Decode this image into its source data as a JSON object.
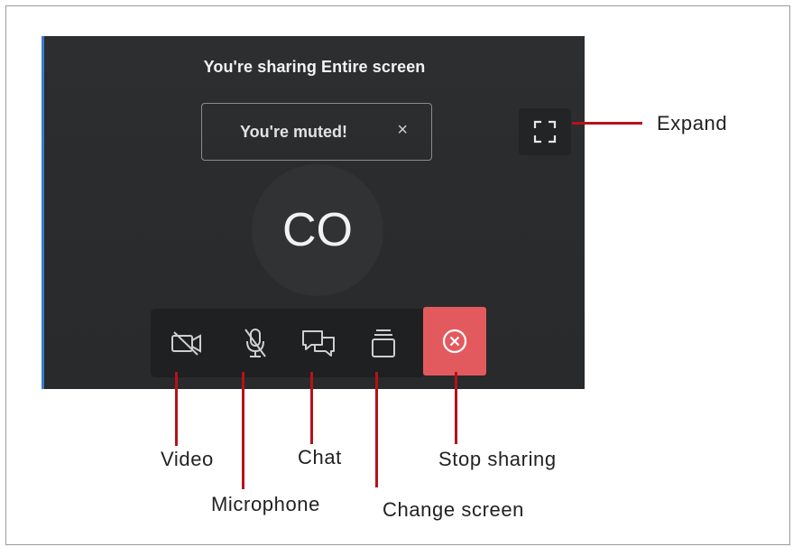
{
  "screen": {
    "share_title": "You're sharing Entire screen",
    "toast_text": "You're muted!",
    "toast_close": "×",
    "avatar_initials": "CO"
  },
  "annotations": {
    "expand": "Expand",
    "video": "Video",
    "microphone": "Microphone",
    "chat": "Chat",
    "change_screen": "Change screen",
    "stop_sharing": "Stop sharing"
  },
  "colors": {
    "stop_button": "#e35a5e",
    "callout_line": "#b5121b",
    "screen_bg": "#2c2e30"
  },
  "icons": [
    "expand-icon",
    "video-off-icon",
    "mic-off-icon",
    "chat-icon",
    "change-screen-icon",
    "stop-sharing-icon"
  ]
}
